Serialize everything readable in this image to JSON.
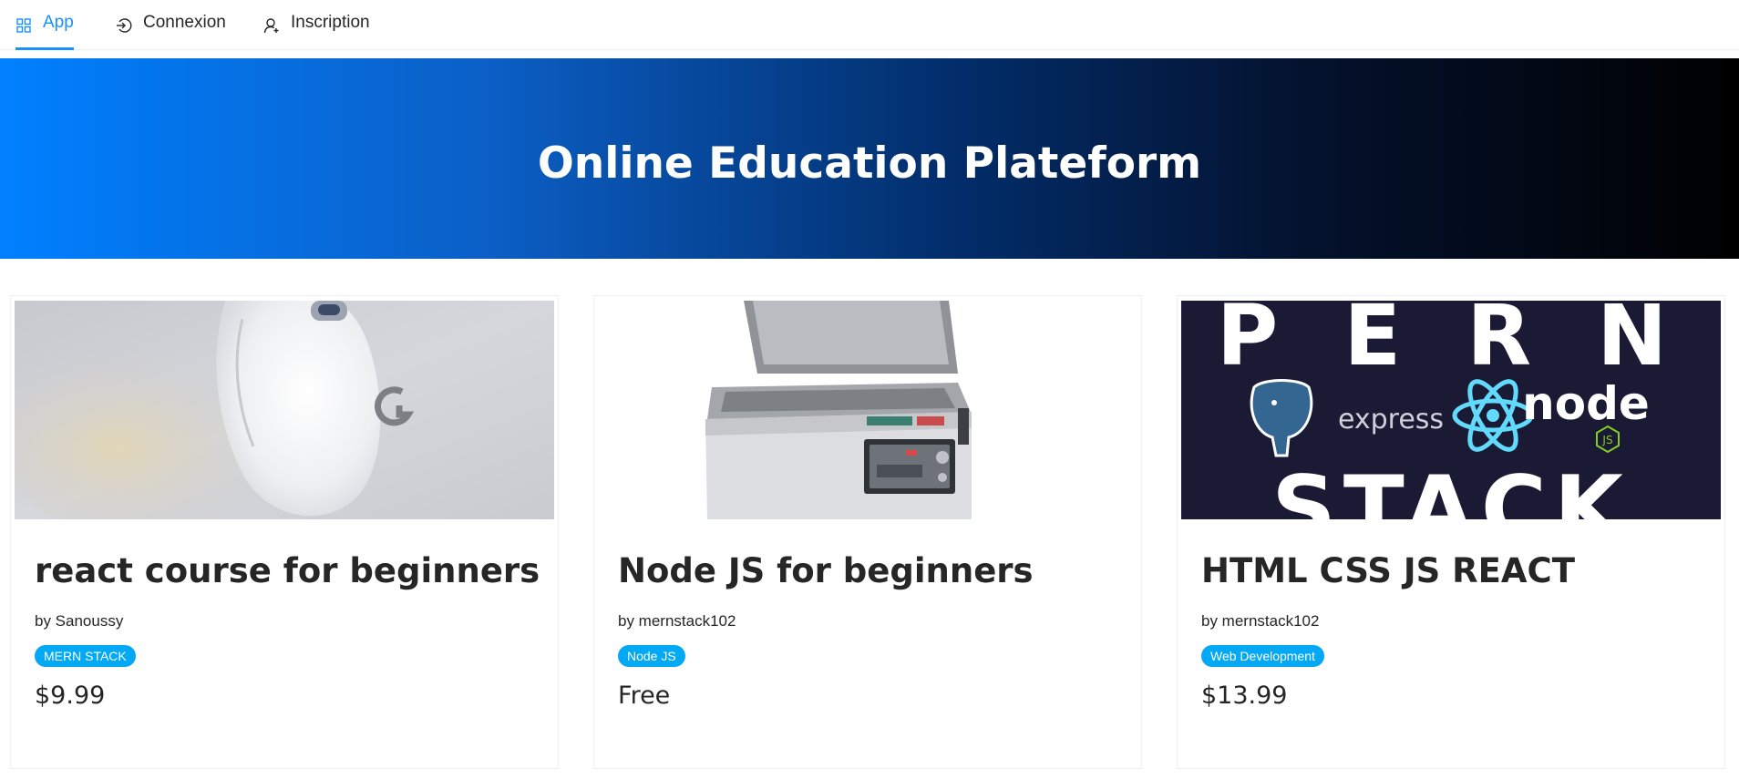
{
  "nav": {
    "items": [
      {
        "label": "App",
        "icon": "grid-icon",
        "active": true
      },
      {
        "label": "Connexion",
        "icon": "login-icon",
        "active": false
      },
      {
        "label": "Inscription",
        "icon": "user-add-icon",
        "active": false
      }
    ]
  },
  "hero": {
    "title": "Online Education Plateform"
  },
  "courses": [
    {
      "title": "react course for beginners",
      "author": "by Sanoussy",
      "category": "MERN STACK",
      "price": "$9.99",
      "image": "white-gaming-mouse-image"
    },
    {
      "title": "Node JS for beginners",
      "author": "by mernstack102",
      "category": "Node JS",
      "price": "Free",
      "image": "vacuum-sealer-machine-image"
    },
    {
      "title": "HTML CSS JS REACT",
      "author": "by mernstack102",
      "category": "Web Development",
      "price": "$13.99",
      "image": "pern-stack-logo-image",
      "image_text": {
        "top": "P E R N",
        "middle": "express",
        "node": "node",
        "js": "JS",
        "bottom": "STACK"
      }
    }
  ],
  "colors": {
    "accent": "#1890ff",
    "tag": "#03a9f4",
    "hero_start": "#0080ff",
    "hero_end": "#000000"
  }
}
